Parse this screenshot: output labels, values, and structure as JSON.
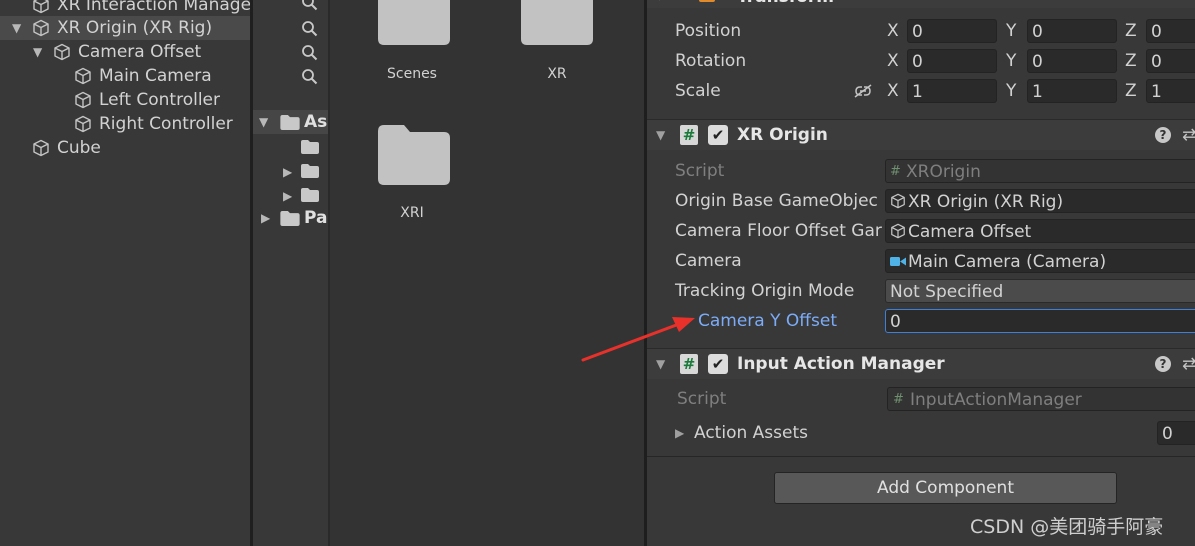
{
  "hierarchy": {
    "items": [
      {
        "label": "XR Interaction Manage"
      },
      {
        "label": "XR Origin (XR Rig)"
      },
      {
        "label": "Camera Offset"
      },
      {
        "label": "Main Camera"
      },
      {
        "label": "Left Controller"
      },
      {
        "label": "Right Controller"
      },
      {
        "label": "Cube"
      }
    ]
  },
  "project_tree": {
    "assets_label": "As",
    "packages_label": "Pa"
  },
  "assets_grid": {
    "folders": [
      {
        "label": "Scenes"
      },
      {
        "label": "XR"
      },
      {
        "label": "XRI"
      }
    ]
  },
  "inspector": {
    "transform": {
      "title": "Transform",
      "position": {
        "label": "Position",
        "x": "0",
        "y": "0",
        "z": "0"
      },
      "rotation": {
        "label": "Rotation",
        "x": "0",
        "y": "0",
        "z": "0"
      },
      "scale": {
        "label": "Scale",
        "x": "1",
        "y": "1",
        "z": "1"
      },
      "axis_x": "X",
      "axis_y": "Y",
      "axis_z": "Z"
    },
    "xr_origin": {
      "title": "XR Origin",
      "help": "?",
      "script_label": "Script",
      "script_value": "XROrigin",
      "origin_base_label": "Origin Base GameObjec",
      "origin_base_value": "XR Origin (XR Rig)",
      "camera_floor_label": "Camera Floor Offset Gar",
      "camera_floor_value": "Camera Offset",
      "camera_label": "Camera",
      "camera_value": "Main Camera (Camera)",
      "tracking_label": "Tracking Origin Mode",
      "tracking_value": "Not Specified",
      "y_offset_label": "Camera Y Offset",
      "y_offset_value": "0"
    },
    "input_action_manager": {
      "title": "Input Action Manager",
      "help": "?",
      "script_label": "Script",
      "script_value": "InputActionManager",
      "action_assets_label": "Action Assets",
      "action_assets_count": "0"
    },
    "add_component_label": "Add Component"
  },
  "watermark": "CSDN @美团骑手阿豪",
  "colors": {
    "accent_blue": "#7cacf8",
    "annotation_arrow": "#e8312a"
  }
}
